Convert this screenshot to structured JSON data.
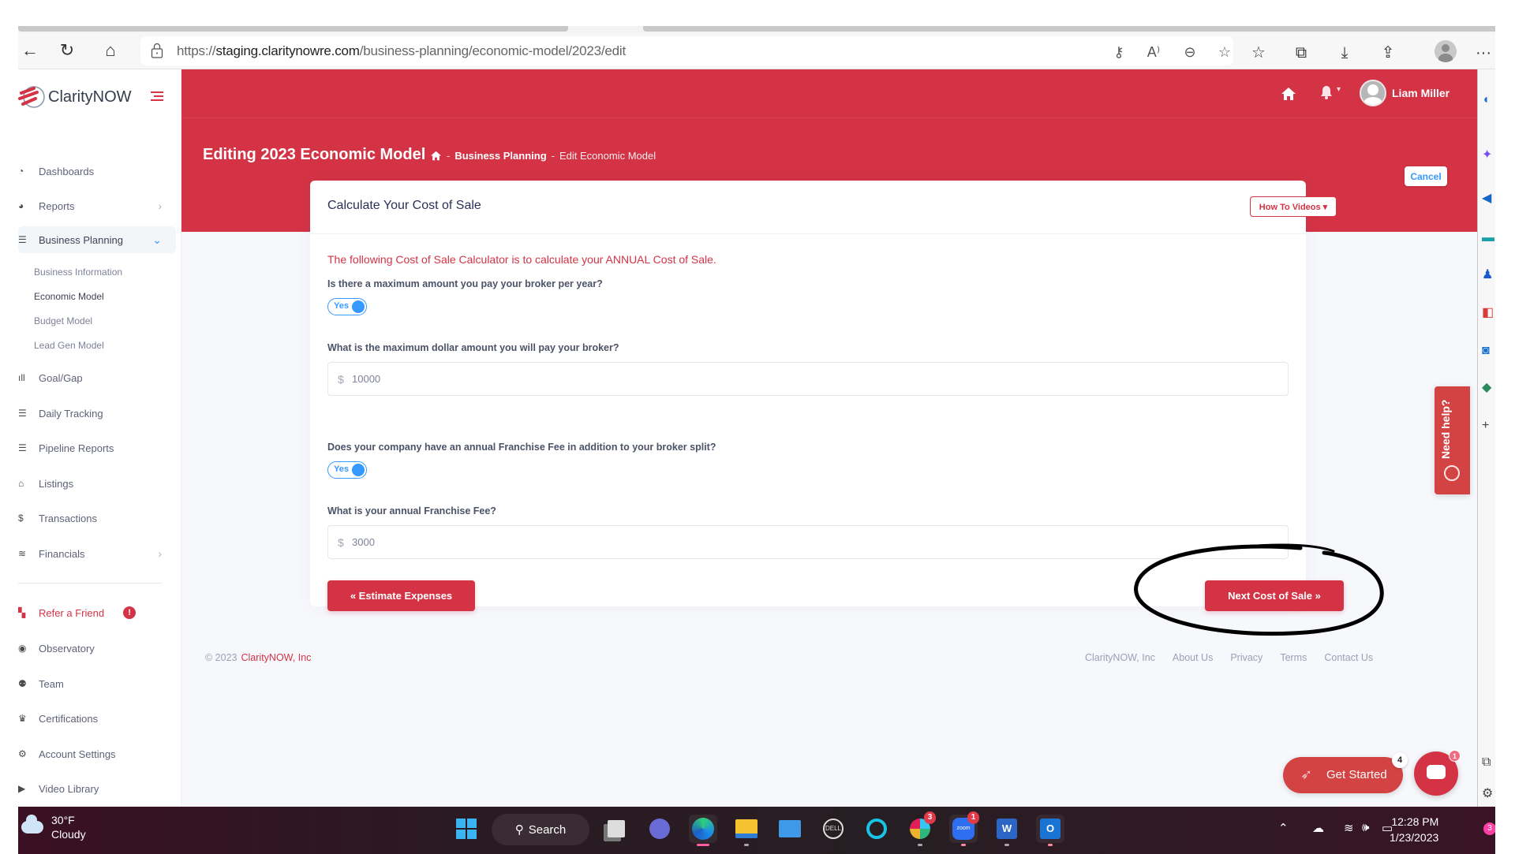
{
  "browser": {
    "url_prefix": "https://",
    "url_host": "staging.claritynowre.com",
    "url_path": "/business-planning/economic-model/2023/edit",
    "more_label": "···"
  },
  "app": {
    "brand": "ClarityNOW",
    "colors": {
      "primary": "#d33345",
      "accent": "#3699ff"
    }
  },
  "sidebar": {
    "items": [
      {
        "label": "Dashboards",
        "icon": "dashboard-icon"
      },
      {
        "label": "Reports",
        "icon": "reports-icon",
        "chevron": "›"
      },
      {
        "label": "Business Planning",
        "icon": "list-icon",
        "chevron": "⌄"
      },
      {
        "label": "Goal/Gap",
        "icon": "bar-chart-icon"
      },
      {
        "label": "Daily Tracking",
        "icon": "list-icon"
      },
      {
        "label": "Pipeline Reports",
        "icon": "list-icon"
      },
      {
        "label": "Listings",
        "icon": "house-icon"
      },
      {
        "label": "Transactions",
        "icon": "dollar-icon"
      },
      {
        "label": "Financials",
        "icon": "coins-icon",
        "chevron": "›"
      },
      {
        "label": "Refer a Friend",
        "icon": "users-icon",
        "badge": "!"
      },
      {
        "label": "Observatory",
        "icon": "eye-icon"
      },
      {
        "label": "Team",
        "icon": "team-icon"
      },
      {
        "label": "Certifications",
        "icon": "crown-icon"
      },
      {
        "label": "Account Settings",
        "icon": "gear-icon"
      },
      {
        "label": "Video Library",
        "icon": "play-icon"
      }
    ],
    "sub_items": [
      {
        "label": "Business Information"
      },
      {
        "label": "Economic Model"
      },
      {
        "label": "Budget Model"
      },
      {
        "label": "Lead Gen Model"
      }
    ]
  },
  "header": {
    "user_name": "Liam Miller",
    "page_title": "Editing 2023 Economic Model",
    "breadcrumb": [
      "Business Planning",
      "Edit Economic Model"
    ],
    "breadcrumb_sep": "-",
    "cancel_label": "Cancel"
  },
  "card": {
    "title": "Calculate Your Cost of Sale",
    "how_to_label": "How To Videos ▾",
    "intro": "The following Cost of Sale Calculator is to calculate your ANNUAL Cost of Sale.",
    "q1": "Is there a maximum amount you pay your broker per year?",
    "q1_toggle": "Yes",
    "q2": "What is the maximum dollar amount you will pay your broker?",
    "q2_currency": "$",
    "q2_value": "10000",
    "q3": "Does your company have an annual Franchise Fee in addition to your broker split?",
    "q3_toggle": "Yes",
    "q4": "What is your annual Franchise Fee?",
    "q4_currency": "$",
    "q4_value": "3000",
    "back_label": "« Estimate Expenses",
    "next_label": "Next Cost of Sale »"
  },
  "footer": {
    "copyright": "© 2023",
    "brand": "ClarityNOW, Inc",
    "links": [
      "ClarityNOW, Inc",
      "About Us",
      "Privacy",
      "Terms",
      "Contact Us"
    ]
  },
  "widgets": {
    "need_help": "Need help?",
    "get_started": "Get Started",
    "get_started_count": "4",
    "chat_count": "1"
  },
  "taskbar": {
    "temperature": "30°F",
    "weather": "Cloudy",
    "search_label": "Search",
    "slack_badge": "3",
    "zoom_badge": "1",
    "zoom_label": "zoom",
    "word_label": "W",
    "outlook_label": "O",
    "time": "12:28 PM",
    "date": "1/23/2023",
    "notifications": "3"
  }
}
